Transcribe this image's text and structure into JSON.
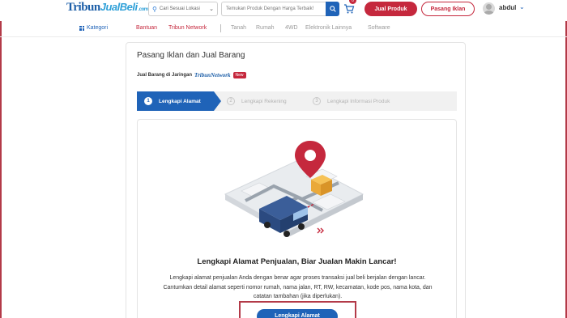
{
  "header": {
    "logo_text_1": "Tribun",
    "logo_text_2": "JualBeli",
    "logo_suffix": ".com",
    "location_select": "Cari Sesuai Lokasi",
    "search_placeholder": "Temukan Produk Dengan Harga Terbaik!",
    "cart_count": "0",
    "jual_produk_label": "Jual Produk",
    "pasang_iklan_label": "Pasang Iklan",
    "username": "abdul"
  },
  "nav": {
    "kategori": "Kategori",
    "bantuan": "Bantuan",
    "tribun_network": "Tribun Network",
    "categories": [
      "Tanah",
      "Rumah",
      "4WD",
      "Elektronik Lainnya",
      "Software"
    ]
  },
  "form": {
    "title": "Pasang Iklan dan Jual Barang",
    "network_label": "Jual Barang di Jaringan",
    "network_logo": "TribunNetwork",
    "new_badge": "New",
    "steps": [
      {
        "num": "1",
        "label": "Lengkapi Alamat"
      },
      {
        "num": "2",
        "label": "Lengkapi Rekening"
      },
      {
        "num": "3",
        "label": "Lengkapi Informasi Produk"
      }
    ],
    "active_step": 1,
    "headline": "Lengkapi Alamat Penjualan, Biar Jualan Makin Lancar!",
    "description": "Lengkapi alamat penjualan Anda dengan benar agar proses transaksi jual beli berjalan dengan lancar. Cantumkan detail alamat seperti nomor rumah, nama jalan, RT, RW, kecamatan, kode pos, nama kota, dan catatan tambahan (jika diperlukan).",
    "cta_label": "Lengkapi Alamat"
  },
  "colors": {
    "primary": "#1f63b8",
    "accent": "#c5283d"
  }
}
